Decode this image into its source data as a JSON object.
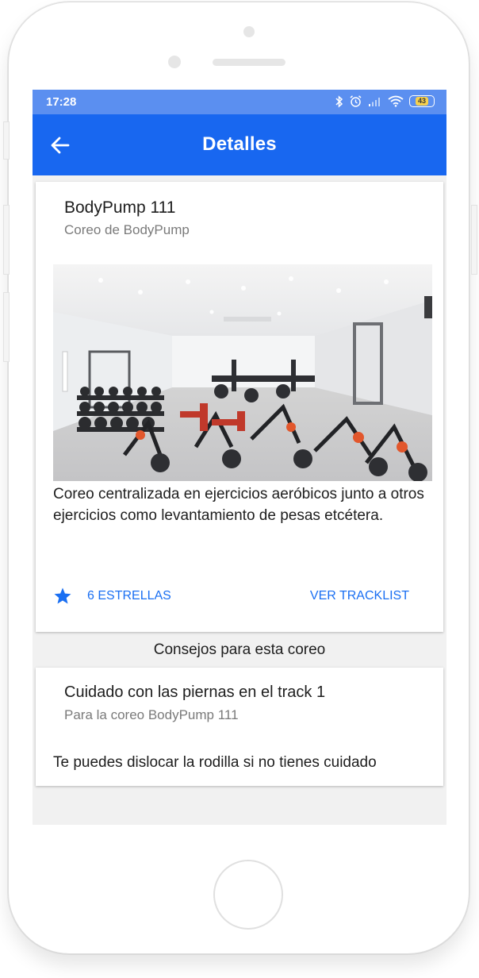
{
  "status_bar": {
    "time": "17:28",
    "battery": "43",
    "icons": [
      "bluetooth-icon",
      "alarm-icon",
      "signal-icon",
      "wifi-icon",
      "battery-icon"
    ]
  },
  "app_bar": {
    "title": "Detalles",
    "back_icon": "arrow-back-icon"
  },
  "choreo_card": {
    "title": "BodyPump 111",
    "subtitle": "Coreo de BodyPump",
    "description": "Coreo centralizada en ejercicios aeróbicos junto a otros ejercicios como levantamiento de pesas etcétera.",
    "stars_label": "6 ESTRELLAS",
    "tracklist_label": "VER TRACKLIST"
  },
  "tips_section": {
    "label": "Consejos para esta coreo",
    "items": [
      {
        "title": "Cuidado con las piernas en el track 1",
        "subtitle": "Para la coreo BodyPump 111",
        "body": "Te puedes dislocar la rodilla si no tienes cuidado"
      }
    ]
  },
  "colors": {
    "status_bar": "#5b8ff0",
    "app_bar": "#1867f0",
    "accent": "#1a6ff2",
    "screen_bg": "#f1f1f1"
  }
}
